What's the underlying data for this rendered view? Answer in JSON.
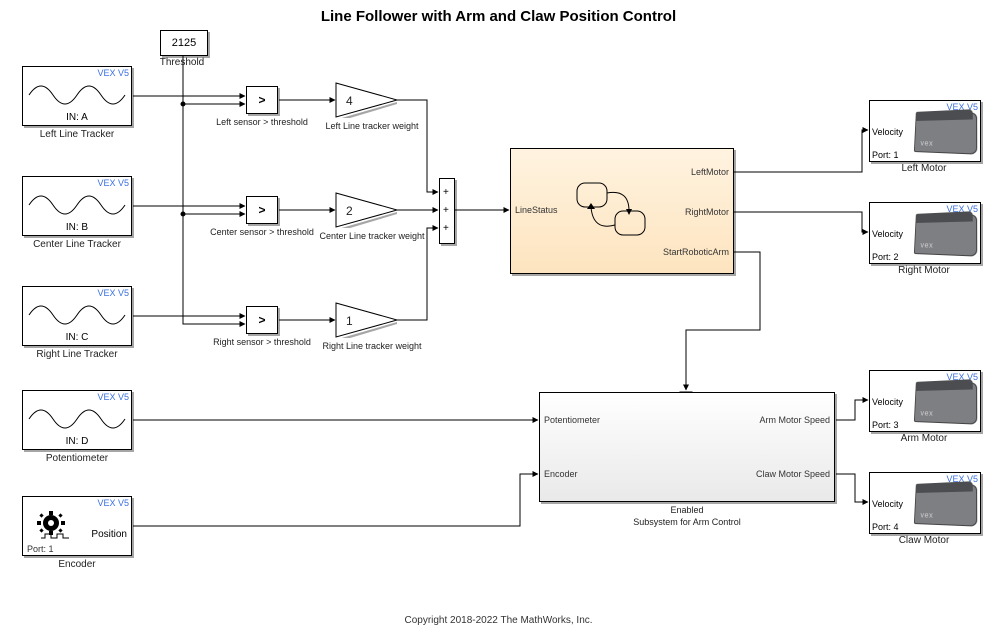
{
  "title": "Line Follower with Arm and Claw Position Control",
  "copyright": "Copyright 2018-2022 The MathWorks, Inc.",
  "vexTag": "VEX V5",
  "threshold": {
    "value": "2125",
    "label": "Threshold"
  },
  "sensors": {
    "left": {
      "label": "Left Line Tracker",
      "port": "IN: A"
    },
    "center": {
      "label": "Center Line Tracker",
      "port": "IN: B"
    },
    "right": {
      "label": "Right Line Tracker",
      "port": "IN: C"
    },
    "pot": {
      "label": "Potentiometer",
      "port": "IN: D"
    }
  },
  "encoder": {
    "label": "Encoder",
    "pos": "Position",
    "port": "Port: 1"
  },
  "compare": {
    "op": ">",
    "left_label": "Left sensor > threshold",
    "center_label": "Center sensor > threshold",
    "right_label": "Right sensor > threshold"
  },
  "gain": {
    "left": {
      "value": "4",
      "label": "Left Line tracker weight"
    },
    "center": {
      "value": "2",
      "label": "Center Line tracker weight"
    },
    "right": {
      "value": "1",
      "label": "Right Line tracker weight"
    }
  },
  "sum": {
    "signs": [
      "+",
      "+",
      "+"
    ]
  },
  "stateflow": {
    "in": "LineStatus",
    "out_left": "LeftMotor",
    "out_right": "RightMotor",
    "out_arm": "StartRoboticArm"
  },
  "armSubsys": {
    "label1": "Enabled",
    "label2": "Subsystem for Arm Control",
    "in_pot": "Potentiometer",
    "in_enc": "Encoder",
    "out_arm": "Arm Motor Speed",
    "out_claw": "Claw Motor Speed"
  },
  "motors": {
    "left": {
      "label": "Left Motor",
      "port": "Port: 1",
      "vin": "Velocity"
    },
    "right": {
      "label": "Right Motor",
      "port": "Port: 2",
      "vin": "Velocity"
    },
    "arm": {
      "label": "Arm Motor",
      "port": "Port: 3",
      "vin": "Velocity"
    },
    "claw": {
      "label": "Claw Motor",
      "port": "Port: 4",
      "vin": "Velocity"
    }
  },
  "chart_data": {
    "type": "diagram-block",
    "note": "Simulink block diagram. Nodes and directed edges are the content.",
    "nodes": [
      {
        "id": "const_threshold",
        "type": "Constant",
        "value": 2125
      },
      {
        "id": "left_tracker",
        "type": "AnalogInput",
        "port": "A",
        "hw": "VEX V5"
      },
      {
        "id": "center_tracker",
        "type": "AnalogInput",
        "port": "B",
        "hw": "VEX V5"
      },
      {
        "id": "right_tracker",
        "type": "AnalogInput",
        "port": "C",
        "hw": "VEX V5"
      },
      {
        "id": "potentiometer",
        "type": "AnalogInput",
        "port": "D",
        "hw": "VEX V5"
      },
      {
        "id": "encoder",
        "type": "Encoder",
        "port": 1,
        "hw": "VEX V5",
        "out": "Position"
      },
      {
        "id": "cmp_left",
        "type": "Compare",
        "op": ">"
      },
      {
        "id": "cmp_center",
        "type": "Compare",
        "op": ">"
      },
      {
        "id": "cmp_right",
        "type": "Compare",
        "op": ">"
      },
      {
        "id": "gain_left",
        "type": "Gain",
        "k": 4
      },
      {
        "id": "gain_center",
        "type": "Gain",
        "k": 2
      },
      {
        "id": "gain_right",
        "type": "Gain",
        "k": 1
      },
      {
        "id": "sum",
        "type": "Sum",
        "signs": "+++"
      },
      {
        "id": "stateflow",
        "type": "StateflowChart",
        "in": [
          "LineStatus"
        ],
        "out": [
          "LeftMotor",
          "RightMotor",
          "StartRoboticArm"
        ]
      },
      {
        "id": "arm_subsys",
        "type": "EnabledSubsystem",
        "in": [
          "Potentiometer",
          "Encoder"
        ],
        "out": [
          "Arm Motor Speed",
          "Claw Motor Speed"
        ]
      },
      {
        "id": "left_motor",
        "type": "SmartMotor",
        "port": 1,
        "hw": "VEX V5",
        "in": "Velocity"
      },
      {
        "id": "right_motor",
        "type": "SmartMotor",
        "port": 2,
        "hw": "VEX V5",
        "in": "Velocity"
      },
      {
        "id": "arm_motor",
        "type": "SmartMotor",
        "port": 3,
        "hw": "VEX V5",
        "in": "Velocity"
      },
      {
        "id": "claw_motor",
        "type": "SmartMotor",
        "port": 4,
        "hw": "VEX V5",
        "in": "Velocity"
      }
    ],
    "edges": [
      [
        "left_tracker",
        "cmp_left.u1"
      ],
      [
        "center_tracker",
        "cmp_center.u1"
      ],
      [
        "right_tracker",
        "cmp_right.u1"
      ],
      [
        "const_threshold",
        "cmp_left.u2"
      ],
      [
        "const_threshold",
        "cmp_center.u2"
      ],
      [
        "const_threshold",
        "cmp_right.u2"
      ],
      [
        "cmp_left",
        "gain_left"
      ],
      [
        "cmp_center",
        "gain_center"
      ],
      [
        "cmp_right",
        "gain_right"
      ],
      [
        "gain_left",
        "sum.+1"
      ],
      [
        "gain_center",
        "sum.+2"
      ],
      [
        "gain_right",
        "sum.+3"
      ],
      [
        "sum",
        "stateflow.LineStatus"
      ],
      [
        "stateflow.LeftMotor",
        "left_motor.Velocity"
      ],
      [
        "stateflow.RightMotor",
        "right_motor.Velocity"
      ],
      [
        "stateflow.StartRoboticArm",
        "arm_subsys.Enable"
      ],
      [
        "potentiometer",
        "arm_subsys.Potentiometer"
      ],
      [
        "encoder.Position",
        "arm_subsys.Encoder"
      ],
      [
        "arm_subsys.Arm Motor Speed",
        "arm_motor.Velocity"
      ],
      [
        "arm_subsys.Claw Motor Speed",
        "claw_motor.Velocity"
      ]
    ]
  }
}
